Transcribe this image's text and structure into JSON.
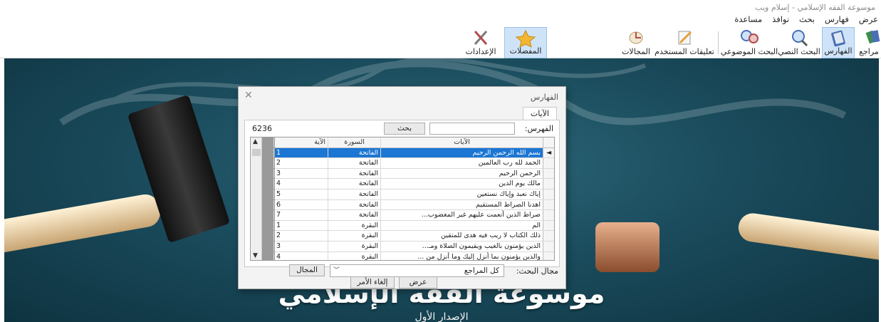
{
  "window": {
    "title": "موسوعة الفقه الإسلامي - إسلام ويب"
  },
  "menu": [
    "عرض",
    "فهارس",
    "بحث",
    "نوافذ",
    "مساعدة"
  ],
  "toolbar": {
    "references": "مراجع",
    "indexes": "الفهارس",
    "text_search": "البحث النصي",
    "topic_search": "البحث الموضوعي",
    "user_notes": "تعليقات المستخدم",
    "fields": "المجالات",
    "favorites": "المفضلات",
    "settings": "الإعدادات"
  },
  "dialog": {
    "title": "الفهارس",
    "tab": "الآيات",
    "index_label": "الفهرس:",
    "search_value": "",
    "search_button": "بحث",
    "count": "6236",
    "columns": {
      "text": "الآيات",
      "sura": "السورة",
      "aya": "الآية"
    },
    "rows": [
      {
        "text": "بسم الله الرحمن الرحيم",
        "sura": "الفاتحة",
        "aya": "1"
      },
      {
        "text": "الحمد لله رب العالمين",
        "sura": "الفاتحة",
        "aya": "2"
      },
      {
        "text": "الرحمن الرحيم",
        "sura": "الفاتحة",
        "aya": "3"
      },
      {
        "text": "مالك يوم الدين",
        "sura": "الفاتحة",
        "aya": "4"
      },
      {
        "text": "إياك نعبد وإياك نستعين",
        "sura": "الفاتحة",
        "aya": "5"
      },
      {
        "text": "اهدنا الصراط المستقيم",
        "sura": "الفاتحة",
        "aya": "6"
      },
      {
        "text": "صراط الذين أنعمت عليهم غير المغضوب...",
        "sura": "الفاتحة",
        "aya": "7"
      },
      {
        "text": "الم",
        "sura": "البقرة",
        "aya": "1"
      },
      {
        "text": "ذلك الكتاب لا ريب فيه هدى للمتقين",
        "sura": "البقرة",
        "aya": "2"
      },
      {
        "text": "الذين يؤمنون بالغيب ويقيمون الصلاة ومـ...",
        "sura": "البقرة",
        "aya": "3"
      },
      {
        "text": "والذين يؤمنون بما أنزل إليك وما أنزل من ...",
        "sura": "البقرة",
        "aya": "4"
      }
    ],
    "selected_row": 0,
    "scope_label": "مجال البحث:",
    "scope_value": "كل المراجع",
    "field_button": "المجال",
    "show_button": "عرض",
    "cancel_button": "إلغاء الأمر"
  },
  "splash": {
    "title": "موسوعة الفقه الإسلامي",
    "subtitle": "الإصدار الأول"
  },
  "colors": {
    "selection": "#1c76d3",
    "active_toolbar": "#cfe3f8",
    "background_dark": "#0e3340"
  }
}
